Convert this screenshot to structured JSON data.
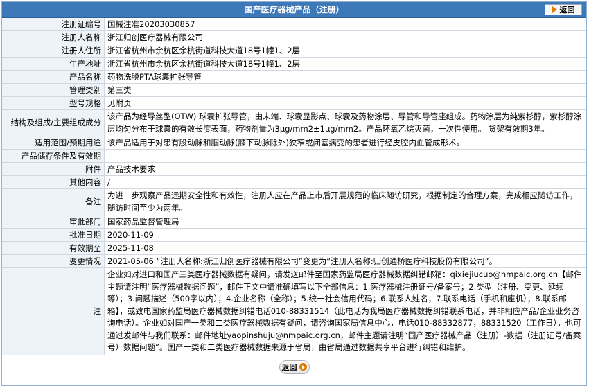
{
  "header": {
    "title": "国产医疗器械产品（注册）",
    "back_label": "返回"
  },
  "rows": [
    {
      "label": "注册证编号",
      "value": "国械注准20203030857"
    },
    {
      "label": "注册人名称",
      "value": "浙江归创医疗器械有限公司"
    },
    {
      "label": "注册人住所",
      "value": "浙江省杭州市余杭区余杭街道科技大道18号1幢1、2层"
    },
    {
      "label": "生产地址",
      "value": "浙江省杭州市余杭区余杭街道科技大道18号1幢1、2层"
    },
    {
      "label": "产品名称",
      "value": "药物洗脱PTA球囊扩张导管"
    },
    {
      "label": "管理类别",
      "value": "第三类"
    },
    {
      "label": "型号规格",
      "value": "见附页"
    },
    {
      "label": "结构及组成/主要组成成分",
      "value": "该产品为经导丝型(OTW) 球囊扩张导管，由末端、球囊显影点、球囊及药物涂层、导管和导管座组成。药物涂层为纯紫杉醇，紫杉醇涂层均匀分布于球囊的有效长度表面，药物剂量为3μg/mm2±1μg/mm2。产品环氧乙烷灭菌，一次性使用。 货架有效期3年。"
    },
    {
      "label": "适用范围/预期用途",
      "value": "该产品适用于对患有股动脉和腘动脉(膝下动脉除外)狭窄或闭塞病变的患者进行经皮腔内血管成形术。"
    },
    {
      "label": "产品储存条件及有效期",
      "value": ""
    },
    {
      "label": "附件",
      "value": "产品技术要求"
    },
    {
      "label": "其他内容",
      "value": "/"
    },
    {
      "label": "备注",
      "value": "为进一步观察产品远期安全性和有效性，注册人应在产品上市后开展规范的临床随访研究，根据制定的合理方案，完成相应随访工作，随访时间至少为两年。"
    },
    {
      "label": "审批部门",
      "value": "国家药品监督管理局"
    },
    {
      "label": "批准日期",
      "value": "2020-11-09"
    },
    {
      "label": "有效期至",
      "value": "2025-11-08"
    },
    {
      "label": "变更情况",
      "value": "2021-05-06 “注册人名称:浙江归创医疗器械有限公司”变更为“注册人名称:归创通桥医疗科技股份有限公司”。"
    },
    {
      "label": "注",
      "value": "企业如对进口和国产三类医疗器械数据有疑问，请发送邮件至国家药监局医疗器械数据纠错邮箱：qixiejiucuo@nmpaic.org.cn【邮件主题请注明“医疗器械数据问题”，邮件正文中请准确填写以下全部信息：1.医疗器械注册证号/备案号；2.类型（注册、变更、延续等）；3.问题描述（500字以内）；4.企业名称（全称）；5.统一社会信用代码；6.联系人姓名；7.联系电话（手机和座机）；8.联系邮箱】，或致电国家药监局医疗器械数据纠错电话010-88331514（此电话为我局医疗器械数据纠错联系电话，并非相应产品/企业业务咨询电话）。企业如对国产一类和二类医疗器械数据有疑问，请咨询国家局信息中心，电话010-88332877，88331520（工作日），也可通过发邮件与我们联系：邮件地址yaopinshuju@nmpaic.org.cn，邮件主题请注明“国产医疗器械产品（注册）-数据（注册证号/备案号）数据问题”。国产一类和二类医疗器械数据来源于省局，由省局通过数据共享平台进行纠错和维护。"
    }
  ],
  "footer": {
    "back_label": "返回"
  }
}
